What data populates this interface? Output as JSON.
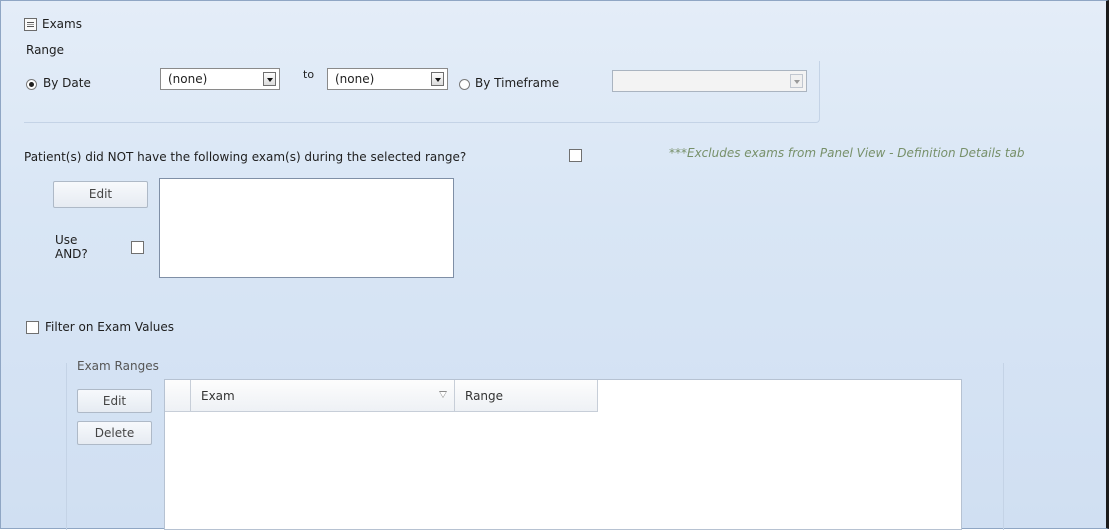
{
  "section": {
    "title": "Exams"
  },
  "range": {
    "label": "Range",
    "by_date_label": "By Date",
    "from_value": "(none)",
    "to_label": "to",
    "to_value": "(none)",
    "by_timeframe_label": "By Timeframe",
    "timeframe_value": "",
    "by_date_selected": true
  },
  "exclusion": {
    "question": "Patient(s) did NOT have the following exam(s) during the selected range?",
    "note": "***Excludes exams from Panel View - Definition Details tab",
    "edit_label": "Edit",
    "use_and_label_line1": "Use",
    "use_and_label_line2": "AND?",
    "checked": false,
    "use_and_checked": false
  },
  "filter": {
    "label": "Filter on Exam Values",
    "checked": false,
    "ranges_label": "Exam Ranges",
    "edit_label": "Edit",
    "delete_label": "Delete",
    "columns": [
      "Exam",
      "Range"
    ],
    "rows": []
  }
}
